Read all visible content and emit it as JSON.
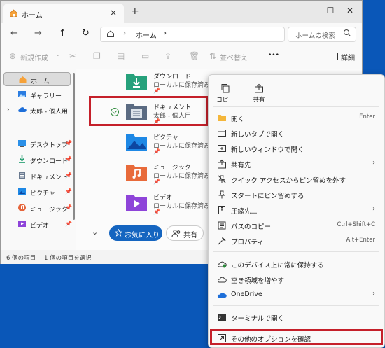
{
  "window": {
    "tab_label": "ホーム",
    "close_tab": "×",
    "new_tab": "+",
    "minimize": "—",
    "maximize": "☐",
    "close": "✕"
  },
  "nav": {
    "back": "←",
    "forward": "→",
    "up": "↑",
    "refresh": "↻",
    "breadcrumb": "ホーム",
    "sep": "›",
    "search_placeholder": "ホームの検索"
  },
  "toolbar": {
    "new": "新規作成",
    "sort": "並べ替え",
    "more": "•••",
    "details": "詳細"
  },
  "sidebar": {
    "items": [
      {
        "label": "ホーム"
      },
      {
        "label": "ギャラリー"
      },
      {
        "label": "太郎 - 個人用"
      },
      {
        "label": "デスクトップ"
      },
      {
        "label": "ダウンロード"
      },
      {
        "label": "ドキュメント"
      },
      {
        "label": "ピクチャ"
      },
      {
        "label": "ミュージック"
      },
      {
        "label": "ビデオ"
      }
    ]
  },
  "folders": [
    {
      "name": "ダウンロード",
      "sub": "ローカルに保存済み"
    },
    {
      "name": "ドキュメント",
      "sub": "太郎 - 個人用"
    },
    {
      "name": "ピクチャ",
      "sub": "ローカルに保存済み"
    },
    {
      "name": "ミュージック",
      "sub": "ローカルに保存済み"
    },
    {
      "name": "ビデオ",
      "sub": "ローカルに保存済み"
    }
  ],
  "sections": {
    "favorites": "お気に入り",
    "shared": "共有"
  },
  "status": {
    "items": "6 個の項目",
    "selected": "1 個の項目を選択"
  },
  "context_menu": {
    "quick": [
      {
        "label": "コピー"
      },
      {
        "label": "共有"
      }
    ],
    "items": [
      {
        "label": "開く",
        "shortcut": "Enter"
      },
      {
        "label": "新しいタブで開く",
        "shortcut": ""
      },
      {
        "label": "新しいウィンドウで開く",
        "shortcut": ""
      },
      {
        "label": "共有先",
        "shortcut": ""
      },
      {
        "label": "クイック アクセスからピン留めを外す",
        "shortcut": ""
      },
      {
        "label": "スタートにピン留めする",
        "shortcut": ""
      },
      {
        "label": "圧縮先...",
        "shortcut": ""
      },
      {
        "label": "パスのコピー",
        "shortcut": "Ctrl+Shift+C"
      },
      {
        "label": "プロパティ",
        "shortcut": "Alt+Enter"
      },
      {
        "label": "このデバイス上に常に保持する",
        "shortcut": ""
      },
      {
        "label": "空き領域を増やす",
        "shortcut": ""
      },
      {
        "label": "OneDrive",
        "shortcut": ""
      },
      {
        "label": "ターミナルで開く",
        "shortcut": ""
      },
      {
        "label": "その他のオプションを確認",
        "shortcut": ""
      }
    ],
    "chevron": "›"
  }
}
